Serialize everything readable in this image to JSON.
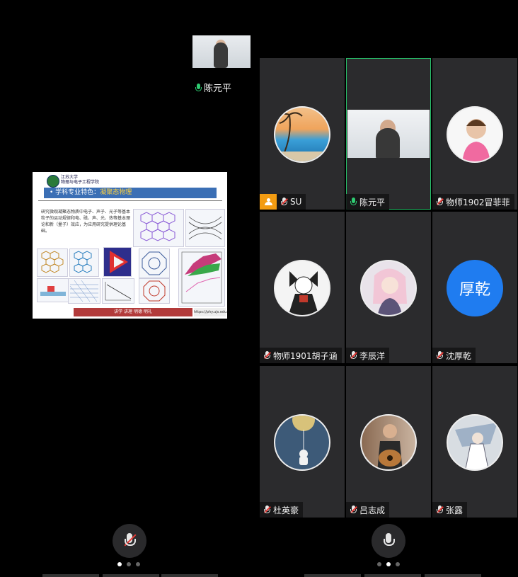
{
  "presenter": {
    "name": "陈元平"
  },
  "slide": {
    "school": "江苏大学",
    "school_sub": "物理与电子工程学院",
    "title_prefix": "学科专业特色：",
    "title_accent": "凝聚态物理",
    "body": "研究微观凝聚态物质中电子、声子、光子等基本粒子的运动规律和电、磁、声、光、热等基本理论和新（量子）效应，为应用研究提供理论基础。",
    "footer": "讲学  讲理  明德  明礼",
    "url": "https://phy.ujs.edu.cn/"
  },
  "participants": [
    {
      "name": "SU",
      "mic": "muted",
      "host": true
    },
    {
      "name": "陈元平",
      "mic": "live",
      "video": true,
      "active": true
    },
    {
      "name": "物师1902冒菲菲",
      "mic": "muted"
    },
    {
      "name": "物师1901胡子涵",
      "mic": "muted"
    },
    {
      "name": "李辰洋",
      "mic": "muted"
    },
    {
      "name": "沈厚乾",
      "mic": "muted",
      "initials": "厚乾"
    },
    {
      "name": "杜英豪",
      "mic": "muted"
    },
    {
      "name": "吕志成",
      "mic": "muted"
    },
    {
      "name": "张露",
      "mic": "muted"
    }
  ],
  "colors": {
    "accent_live": "#2ecc71",
    "muted_red": "#e53935",
    "host_orange": "#f39c12",
    "avatar_blue": "#1f7cf0"
  }
}
